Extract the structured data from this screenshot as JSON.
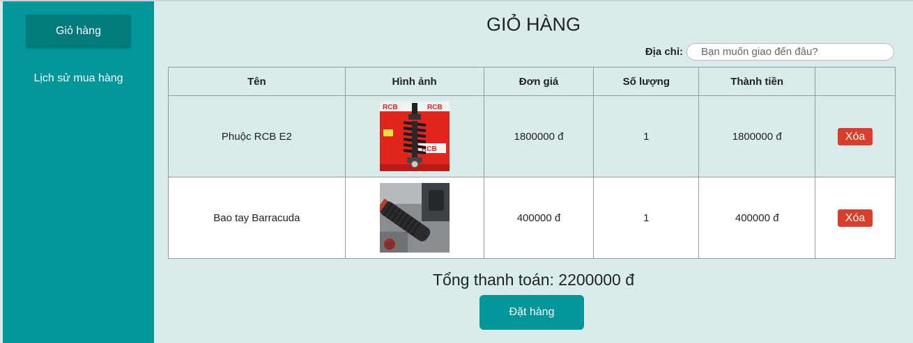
{
  "sidebar": {
    "cart_label": "Giỏ hàng",
    "history_label": "Lịch sử mua hàng"
  },
  "main": {
    "title": "GIỎ HÀNG",
    "address_label": "Địa chỉ:",
    "address_placeholder": "Bạn muốn giao đến đâu?",
    "address_value": ""
  },
  "table": {
    "headers": [
      "Tên",
      "Hình ảnh",
      "Đơn giá",
      "Số lượng",
      "Thành tiền",
      ""
    ],
    "rows": [
      {
        "name": "Phuộc RCB E2",
        "image": "product-image-shock-absorber",
        "price": "1800000 đ",
        "quantity": "1",
        "subtotal": "1800000 đ",
        "delete_label": "Xóa"
      },
      {
        "name": "Bao tay Barracuda",
        "image": "product-image-handlebar-grip",
        "price": "400000 đ",
        "quantity": "1",
        "subtotal": "400000 đ",
        "delete_label": "Xóa"
      }
    ]
  },
  "summary": {
    "total_text": "Tổng thanh toán: 2200000 đ",
    "order_label": "Đặt hàng"
  },
  "colors": {
    "sidebar": "#03979a",
    "sidebar_active": "#037a7c",
    "background": "#d9ebeb",
    "delete_button": "#d93d2b",
    "order_button": "#03979a"
  }
}
